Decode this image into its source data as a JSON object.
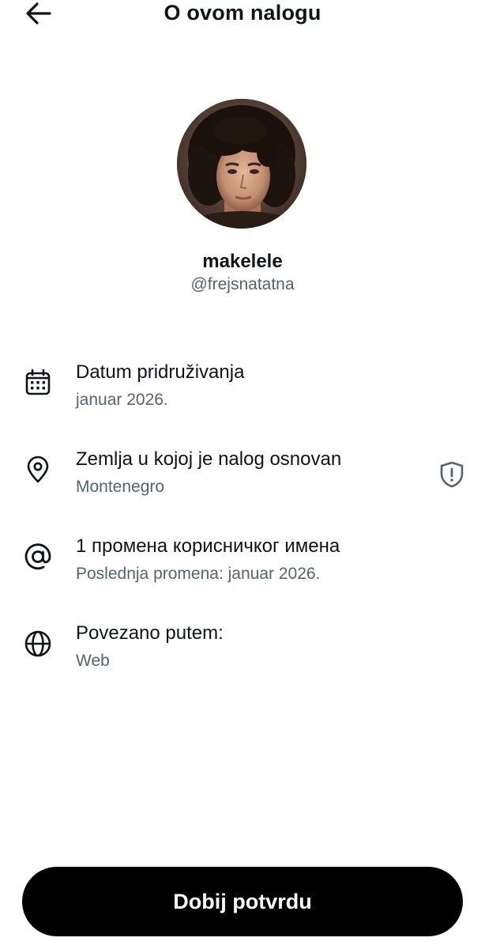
{
  "header": {
    "title": "O ovom nalogu",
    "back_icon": "arrow-left-icon"
  },
  "profile": {
    "name": "makelele",
    "handle": "@frejsnatatna"
  },
  "details": [
    {
      "icon": "calendar-icon",
      "title": "Datum pridruživanja",
      "subtitle": "januar 2026."
    },
    {
      "icon": "location-pin-icon",
      "title": "Zemlja u kojoj je nalog osnovan",
      "subtitle": "Montenegro",
      "action_icon": "shield-alert-icon"
    },
    {
      "icon": "at-sign-icon",
      "title": "1 промена корисничког имена",
      "subtitle": "Poslednja promena: januar 2026."
    },
    {
      "icon": "globe-icon",
      "title": "Povezano putem:",
      "subtitle": "Web"
    }
  ],
  "cta": {
    "label": "Dobij potvrdu"
  },
  "colors": {
    "text": "#0f1419",
    "secondary": "#536471",
    "button_bg": "#000000",
    "button_text": "#ffffff"
  }
}
